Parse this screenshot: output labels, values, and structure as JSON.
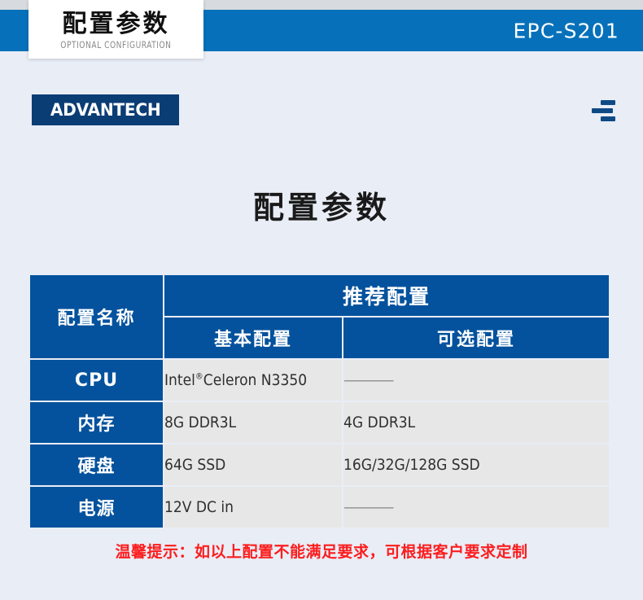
{
  "banner": {
    "badge_title": "配置参数",
    "badge_subtitle": "OPTIONAL CONFIGURATION",
    "model": "EPC-S201"
  },
  "nav": {
    "logo_text": "ADVANTECH",
    "menu_icon": "hamburger-menu-icon"
  },
  "page": {
    "title": "配置参数"
  },
  "table": {
    "group_header": "推荐配置",
    "col_headers": {
      "name": "配置名称",
      "basic": "基本配置",
      "optional": "可选配置"
    },
    "rows": [
      {
        "name": "CPU",
        "basic": "Intel®Celeron N3350",
        "optional": "————"
      },
      {
        "name": "内存",
        "basic": "8G DDR3L",
        "optional": "4G DDR3L"
      },
      {
        "name": "硬盘",
        "basic": "64G SSD",
        "optional": "16G/32G/128G SSD"
      },
      {
        "name": "电源",
        "basic": "12V DC in",
        "optional": "————"
      }
    ]
  },
  "footer": {
    "note": "温馨提示：如以上配置不能满足要求，可根据客户要求定制"
  },
  "colors": {
    "banner_blue": "#0671ba",
    "table_blue": "#04529d",
    "logo_navy": "#0b3d75",
    "page_bg": "#e9edf6",
    "cell_gray": "#e7e7e7",
    "note_red": "#fc1d1d"
  }
}
